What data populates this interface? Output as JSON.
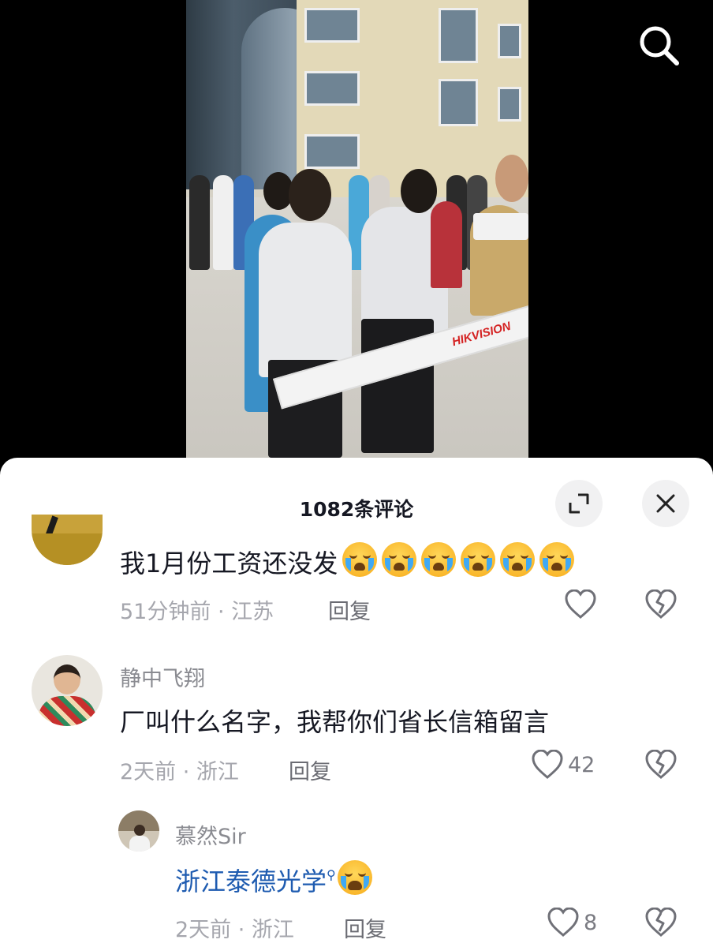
{
  "header": {
    "comment_count_title": "1082条评论"
  },
  "video": {
    "barrier_brand": "HIKVISION"
  },
  "comments": [
    {
      "text": "我1月份工资还没发",
      "emoji_count": 6,
      "time": "51分钟前 · 江苏",
      "reply_label": "回复",
      "likes": ""
    },
    {
      "username": "静中飞翔",
      "text": "厂叫什么名字，我帮你们省长信箱留言",
      "time": "2天前 · 浙江",
      "reply_label": "回复",
      "likes": "42"
    }
  ],
  "reply": {
    "username": "慕然Sir",
    "text": "浙江泰德光学",
    "time": "2天前 · 浙江",
    "reply_label": "回复",
    "likes": "8"
  },
  "icons": {
    "search": "search-icon",
    "expand": "expand-icon",
    "close": "close-icon",
    "like": "heart-icon",
    "dislike": "broken-heart-icon"
  },
  "colors": {
    "link": "#1e5bb0",
    "meta": "#a5a6ad"
  }
}
